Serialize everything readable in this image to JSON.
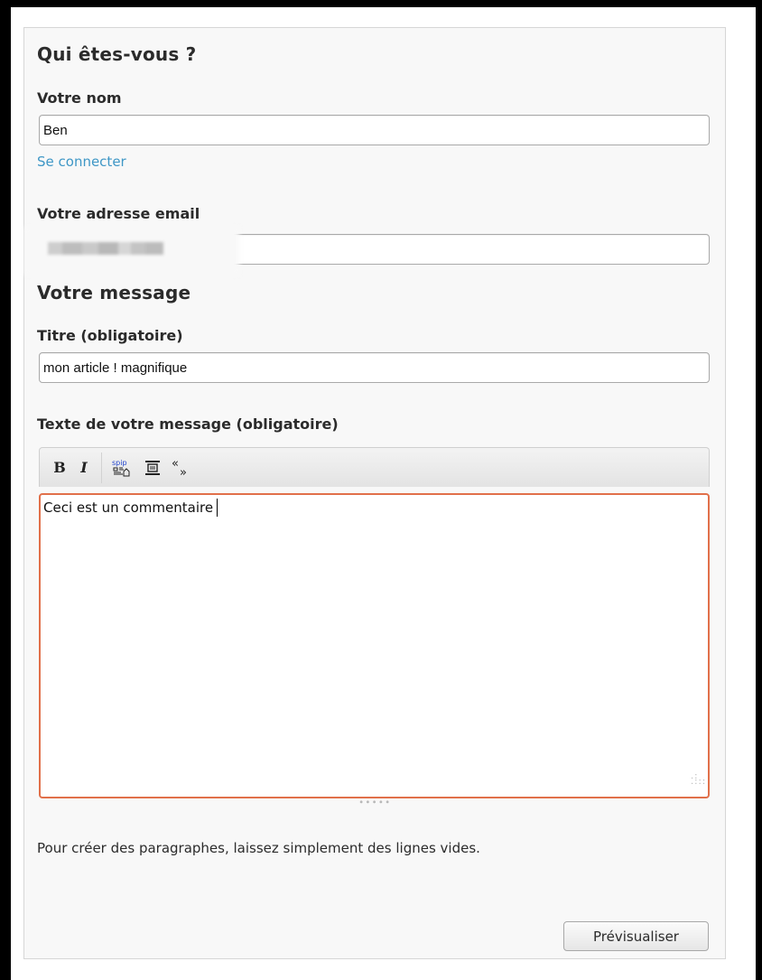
{
  "who": {
    "heading": "Qui êtes-vous ?",
    "name_label": "Votre nom",
    "name_value": "Ben",
    "login_link": "Se connecter",
    "email_label": "Votre adresse email",
    "email_value": ""
  },
  "message": {
    "heading": "Votre message",
    "title_label": "Titre (obligatoire)",
    "title_value": "mon article ! magnifique",
    "text_label": "Texte de votre message (obligatoire)",
    "text_value": "Ceci est un commentaire",
    "hint": "Pour créer des paragraphes, laissez simplement des lignes vides."
  },
  "toolbar": {
    "bold": "B",
    "italic": "I",
    "spip_icon": "spip-link-icon",
    "paragraph_icon": "paragraph-icon",
    "quote": "«»"
  },
  "preview_button": "Prévisualiser",
  "colors": {
    "accent_link": "#3f97c6",
    "focus_border": "#e1704a"
  }
}
